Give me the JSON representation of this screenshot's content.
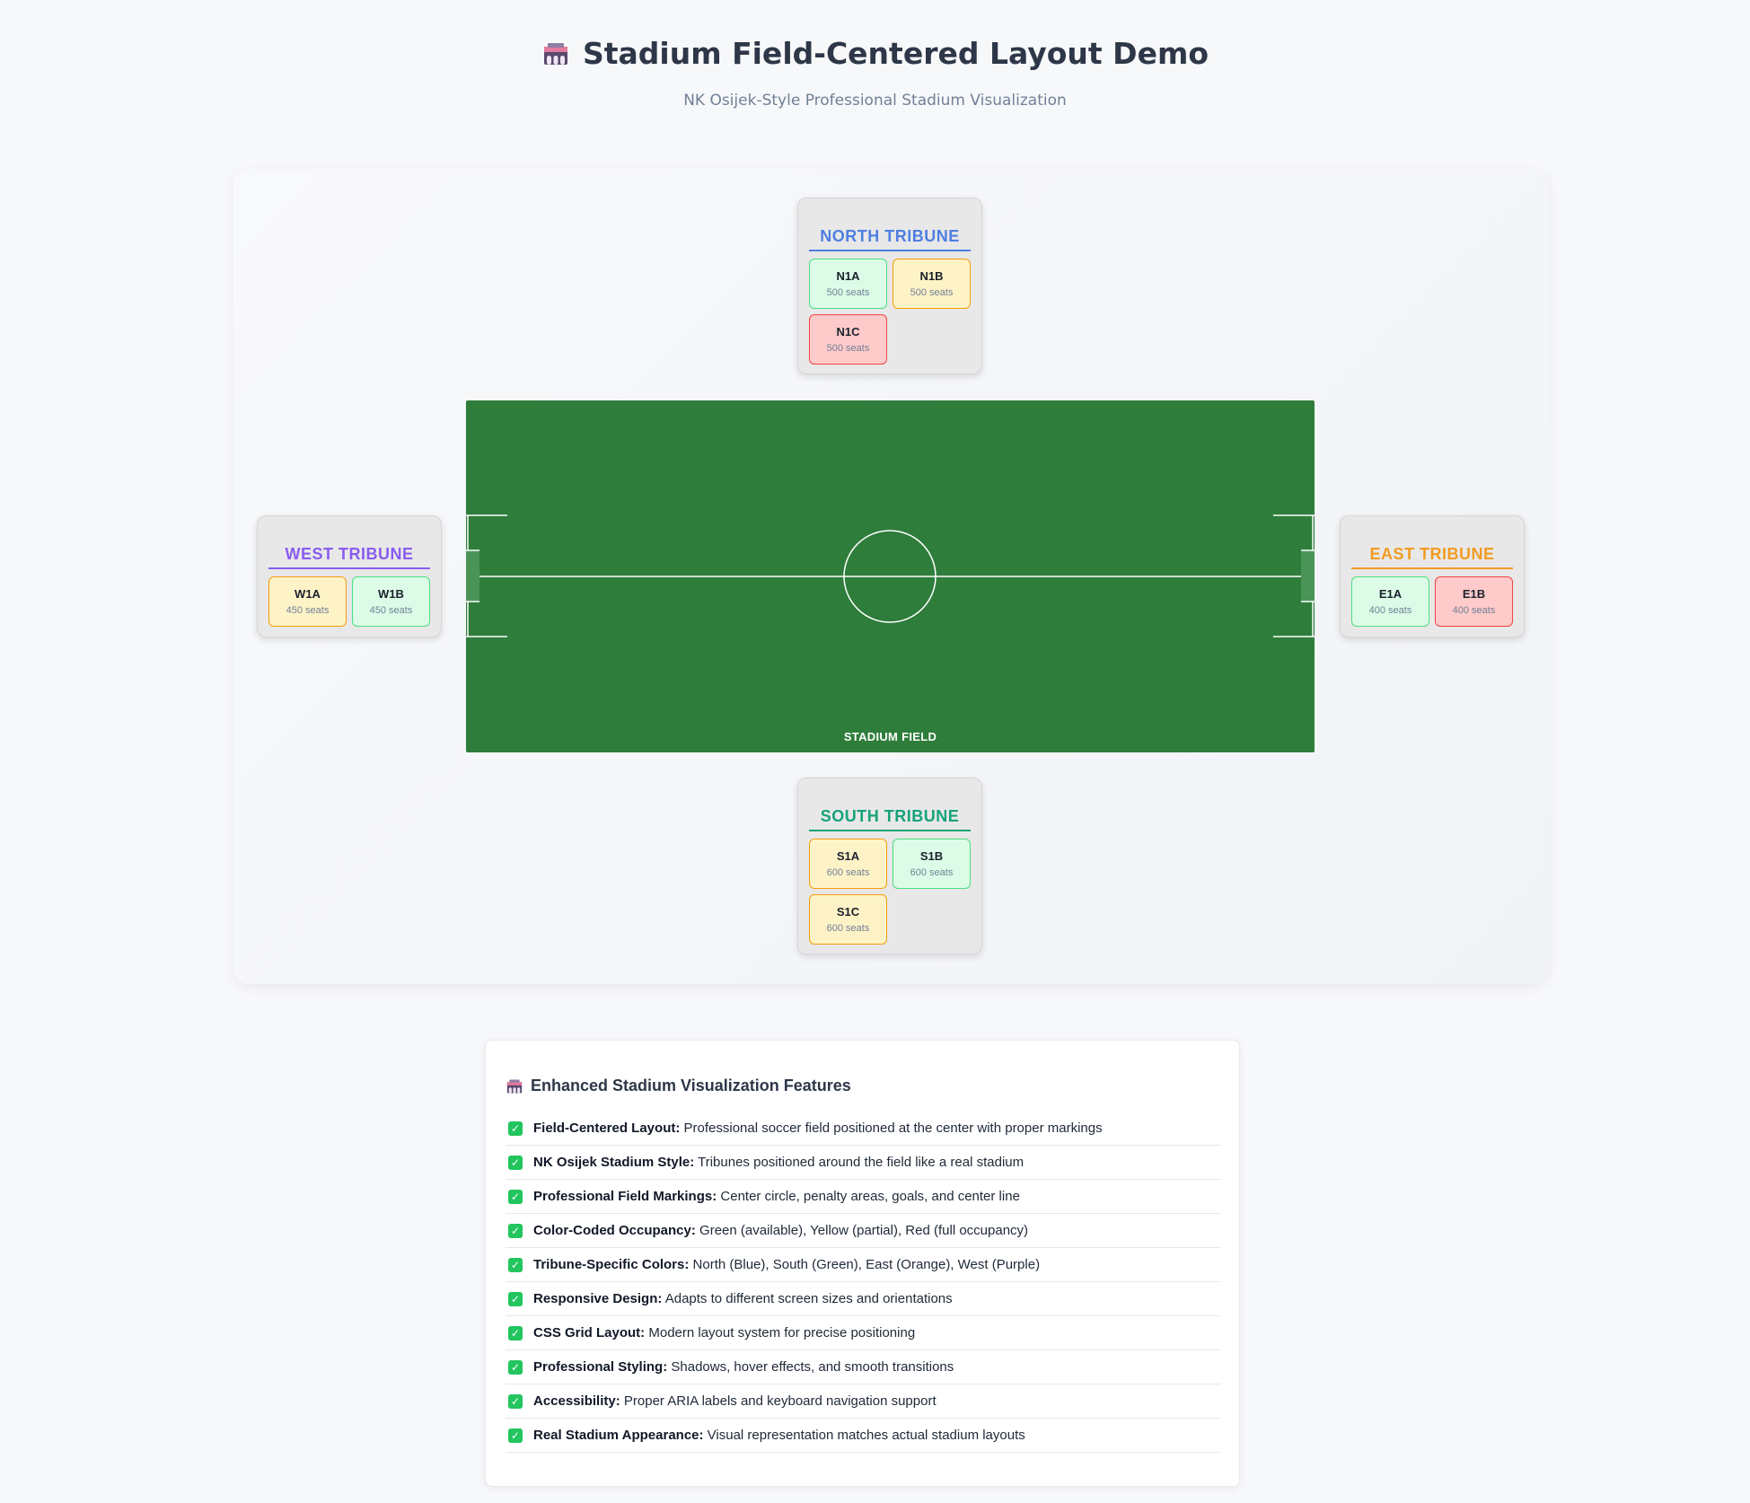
{
  "header": {
    "title": "Stadium Field-Centered Layout Demo",
    "subtitle": "NK Osijek-Style Professional Stadium Visualization"
  },
  "colors": {
    "north": "#4f7fe0",
    "south": "#16a37a",
    "east": "#f29b21",
    "west": "#8a5cf0",
    "field": "#2e7d3a",
    "available": "#dcfce7",
    "partial": "#fef3c7",
    "full": "#fecaca"
  },
  "tribunes": {
    "north": {
      "title": "NORTH TRIBUNE",
      "sections": [
        {
          "code": "N1A",
          "seats": "500 seats",
          "status": "green"
        },
        {
          "code": "N1B",
          "seats": "500 seats",
          "status": "yellow"
        },
        {
          "code": "N1C",
          "seats": "500 seats",
          "status": "red"
        }
      ]
    },
    "west": {
      "title": "WEST TRIBUNE",
      "sections": [
        {
          "code": "W1A",
          "seats": "450 seats",
          "status": "yellow"
        },
        {
          "code": "W1B",
          "seats": "450 seats",
          "status": "green"
        }
      ]
    },
    "east": {
      "title": "EAST TRIBUNE",
      "sections": [
        {
          "code": "E1A",
          "seats": "400 seats",
          "status": "green"
        },
        {
          "code": "E1B",
          "seats": "400 seats",
          "status": "red"
        }
      ]
    },
    "south": {
      "title": "SOUTH TRIBUNE",
      "sections": [
        {
          "code": "S1A",
          "seats": "600 seats",
          "status": "yellow"
        },
        {
          "code": "S1B",
          "seats": "600 seats",
          "status": "green"
        },
        {
          "code": "S1C",
          "seats": "600 seats",
          "status": "yellow"
        }
      ]
    }
  },
  "field": {
    "label": "STADIUM FIELD"
  },
  "features": {
    "title": "Enhanced Stadium Visualization Features",
    "items": [
      {
        "label": "Field-Centered Layout:",
        "text": "Professional soccer field positioned at the center with proper markings"
      },
      {
        "label": "NK Osijek Stadium Style:",
        "text": "Tribunes positioned around the field like a real stadium"
      },
      {
        "label": "Professional Field Markings:",
        "text": "Center circle, penalty areas, goals, and center line"
      },
      {
        "label": "Color-Coded Occupancy:",
        "text": "Green (available), Yellow (partial), Red (full occupancy)"
      },
      {
        "label": "Tribune-Specific Colors:",
        "text": "North (Blue), South (Green), East (Orange), West (Purple)"
      },
      {
        "label": "Responsive Design:",
        "text": "Adapts to different screen sizes and orientations"
      },
      {
        "label": "CSS Grid Layout:",
        "text": "Modern layout system for precise positioning"
      },
      {
        "label": "Professional Styling:",
        "text": "Shadows, hover effects, and smooth transitions"
      },
      {
        "label": "Accessibility:",
        "text": "Proper ARIA labels and keyboard navigation support"
      },
      {
        "label": "Real Stadium Appearance:",
        "text": "Visual representation matches actual stadium layouts"
      }
    ]
  }
}
